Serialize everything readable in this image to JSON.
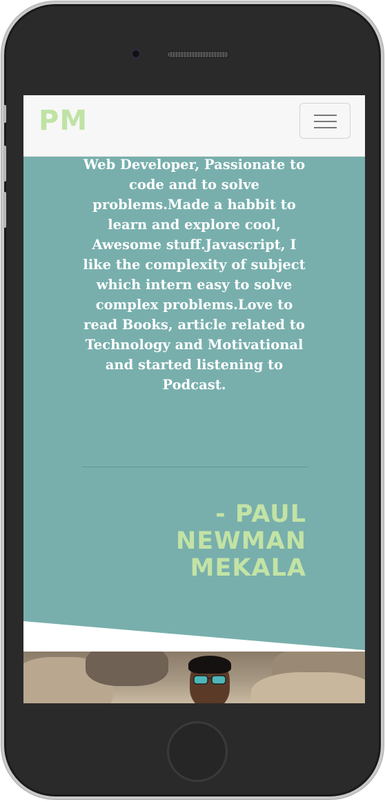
{
  "device": {
    "type": "phone",
    "frame_color": "#2a2a2a",
    "bezel_color": "#c9c9c9"
  },
  "navbar": {
    "brand": "PM",
    "brand_color": "#bfe3a4",
    "toggle_icon": "hamburger-menu-icon"
  },
  "about": {
    "bio": "Web Developer, Passionate to code and to solve problems.Made a habbit to learn and explore cool, Awesome stuff.Javascript, I like the complexity of subject which intern easy to solve complex problems.Love to read Books, article related to Technology and Motivational and started listening to Podcast.",
    "signature": "- PAUL NEWMAN MEKALA",
    "background_color": "#78afad",
    "signature_color": "#c3e3a5"
  },
  "photo": {
    "icon": "profile-photo"
  }
}
